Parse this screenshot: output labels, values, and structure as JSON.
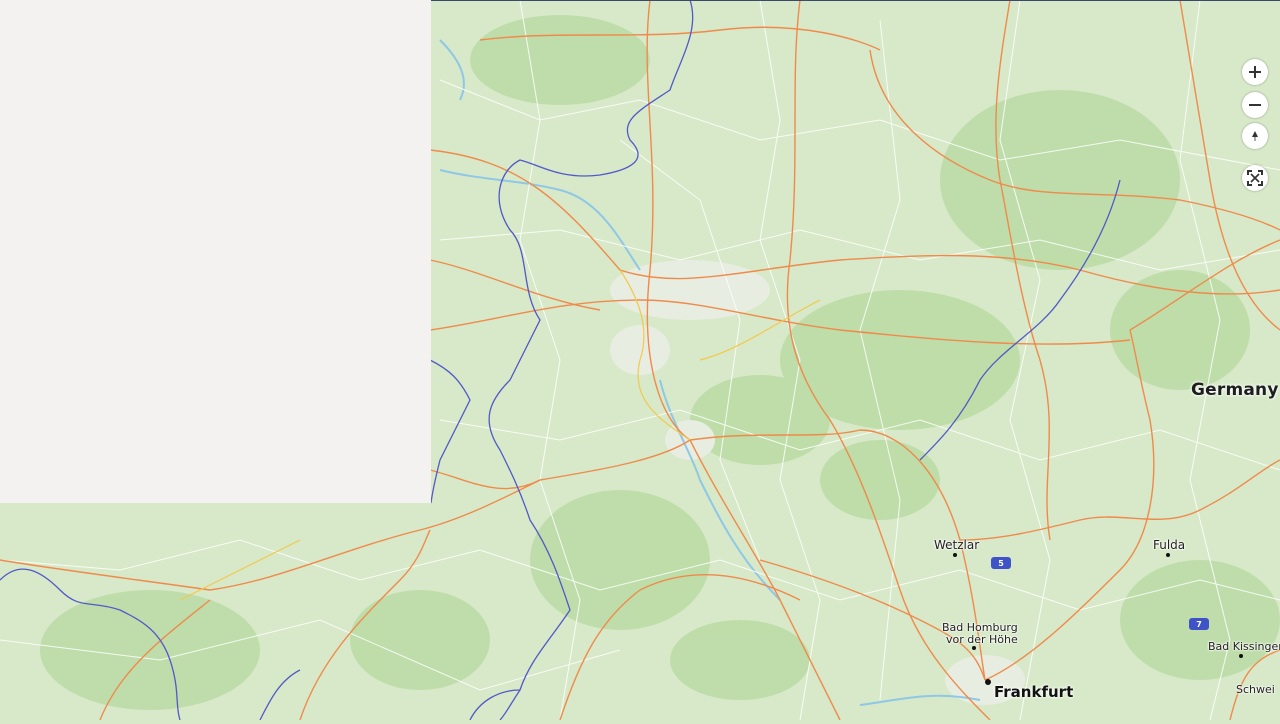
{
  "map": {
    "labels": {
      "country": "Germany",
      "frankfurt": "Frankfurt",
      "wetzlar": "Wetzlar",
      "fulda": "Fulda",
      "bad_homburg_line1": "Bad Homburg",
      "bad_homburg_line2": "vor der Höhe",
      "bad_kissingen": "Bad Kissingen",
      "schweinfurt_partial": "Schwei"
    },
    "route_shields": [
      "5",
      "7"
    ],
    "colors": {
      "land": "#d7e9c8",
      "forest": "#b9d9a1",
      "panel": "#f4f1f1",
      "major_road": "#f08a4b",
      "minor_road": "#ffffff",
      "border": "#5358c9",
      "water": "#9fd3ee"
    }
  },
  "controls": {
    "zoom_in_icon": "plus-icon",
    "zoom_out_icon": "minus-icon",
    "compass_icon": "compass-north-icon",
    "fullscreen_icon": "fullscreen-icon"
  }
}
